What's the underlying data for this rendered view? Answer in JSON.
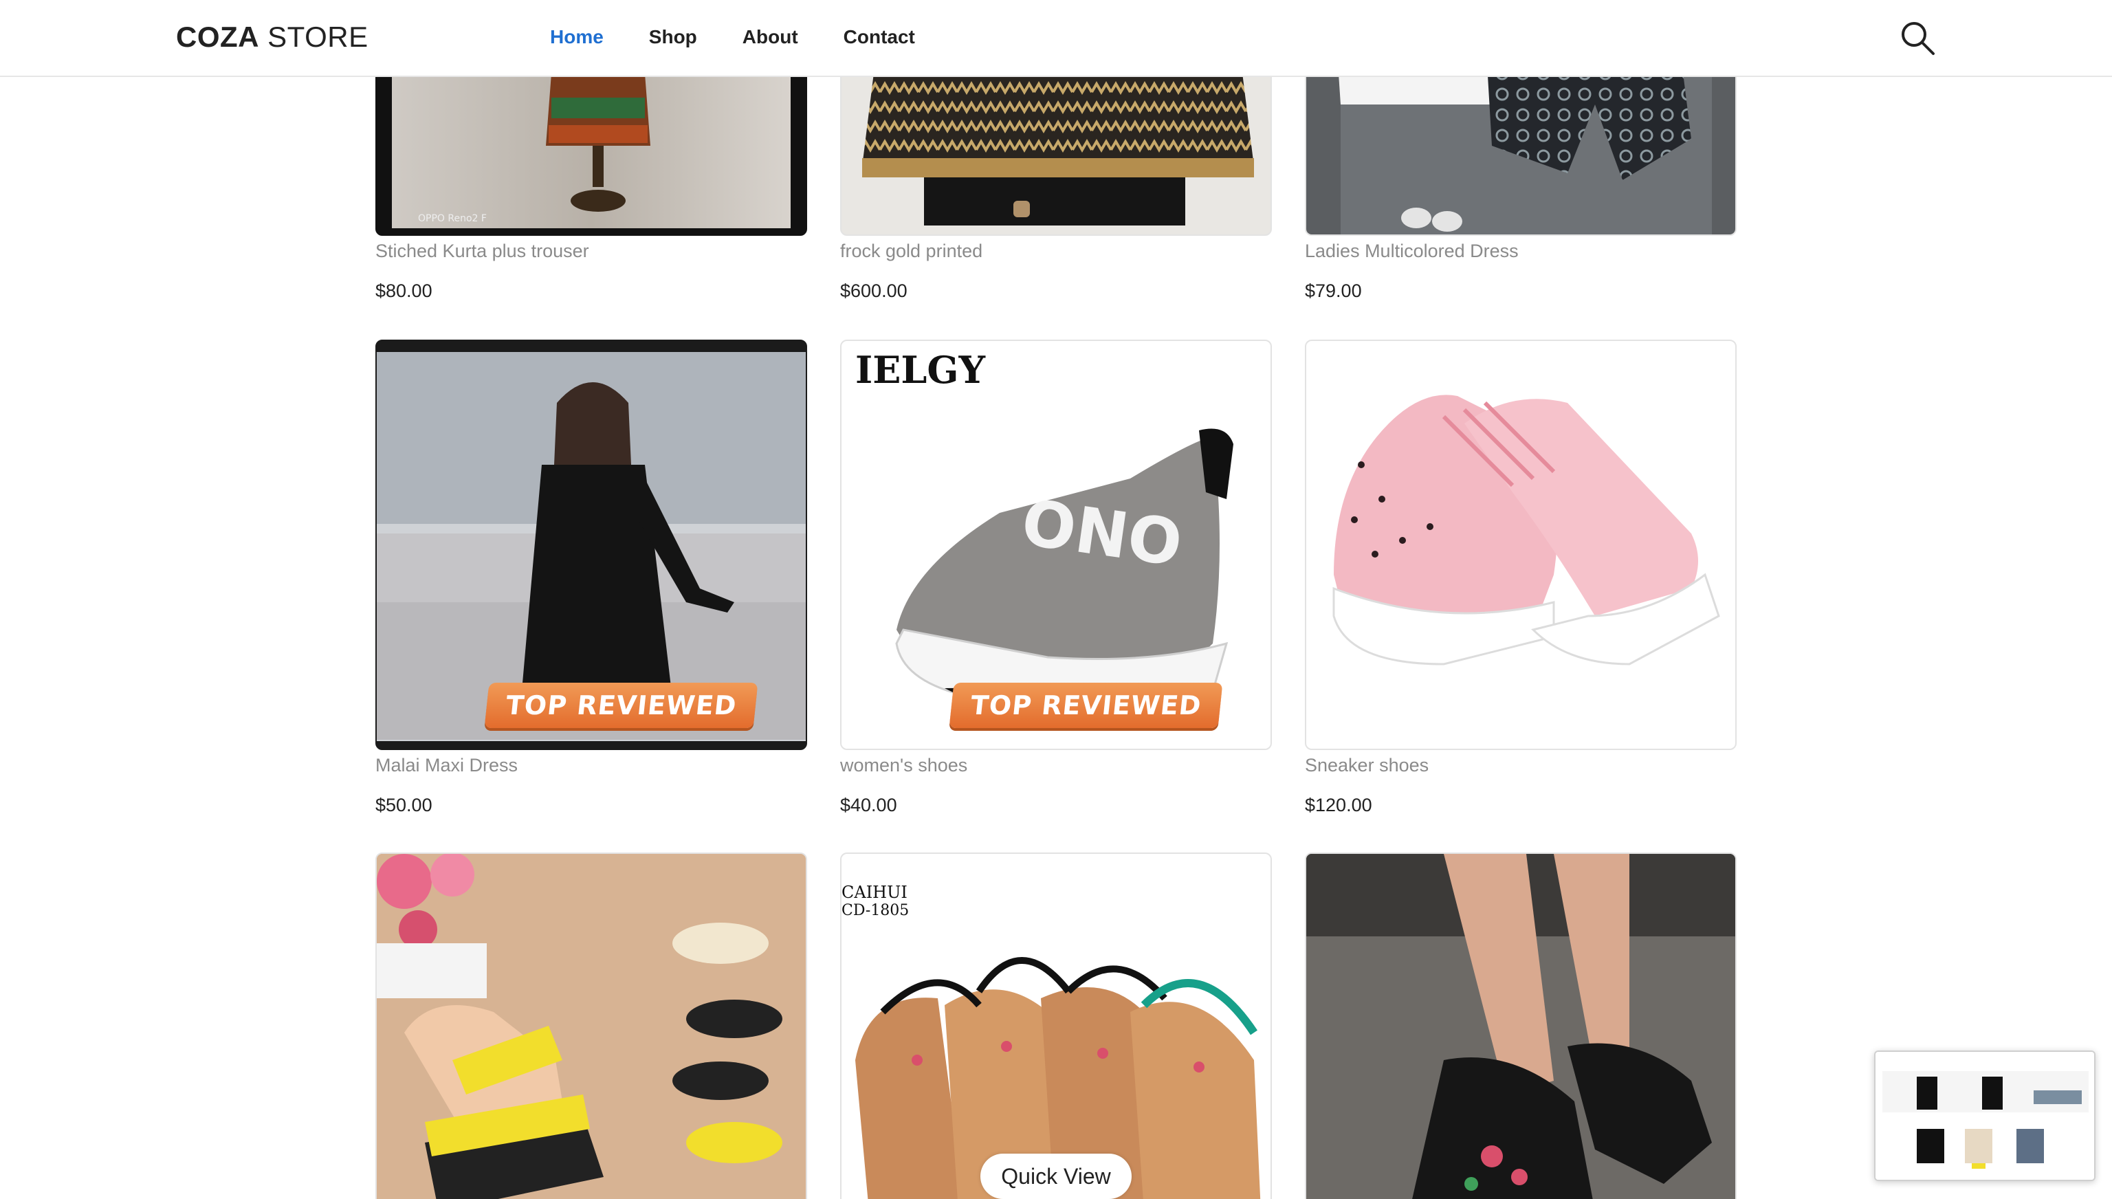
{
  "header": {
    "logo_bold": "COZA",
    "logo_light": "STORE",
    "nav": [
      {
        "label": "Home",
        "active": true
      },
      {
        "label": "Shop",
        "active": false
      },
      {
        "label": "About",
        "active": false
      },
      {
        "label": "Contact",
        "active": false
      }
    ],
    "search_icon": "search-icon"
  },
  "products": [
    {
      "name": "Stiched Kurta plus trouser",
      "price": "$80.00"
    },
    {
      "name": "frock gold printed",
      "price": "$600.00"
    },
    {
      "name": "Ladies Multicolored Dress",
      "price": "$79.00"
    },
    {
      "name": "Malai Maxi Dress",
      "price": "$50.00",
      "badge": "TOP REVIEWED"
    },
    {
      "name": "women's shoes",
      "price": "$40.00",
      "badge": "TOP REVIEWED",
      "image_text": "IELGY",
      "shoe_text": "ONO"
    },
    {
      "name": "Sneaker shoes",
      "price": "$120.00"
    },
    {
      "name": "",
      "price": ""
    },
    {
      "name": "",
      "price": "",
      "image_text_1": "CAIHUI",
      "image_text_2": "CD-1805"
    },
    {
      "name": "",
      "price": ""
    }
  ],
  "quick_view_label": "Quick View",
  "colors": {
    "accent": "#1f6fd1",
    "badge": "#e36c2d",
    "text_dark": "#222222",
    "text_muted": "#8a8a8a"
  }
}
